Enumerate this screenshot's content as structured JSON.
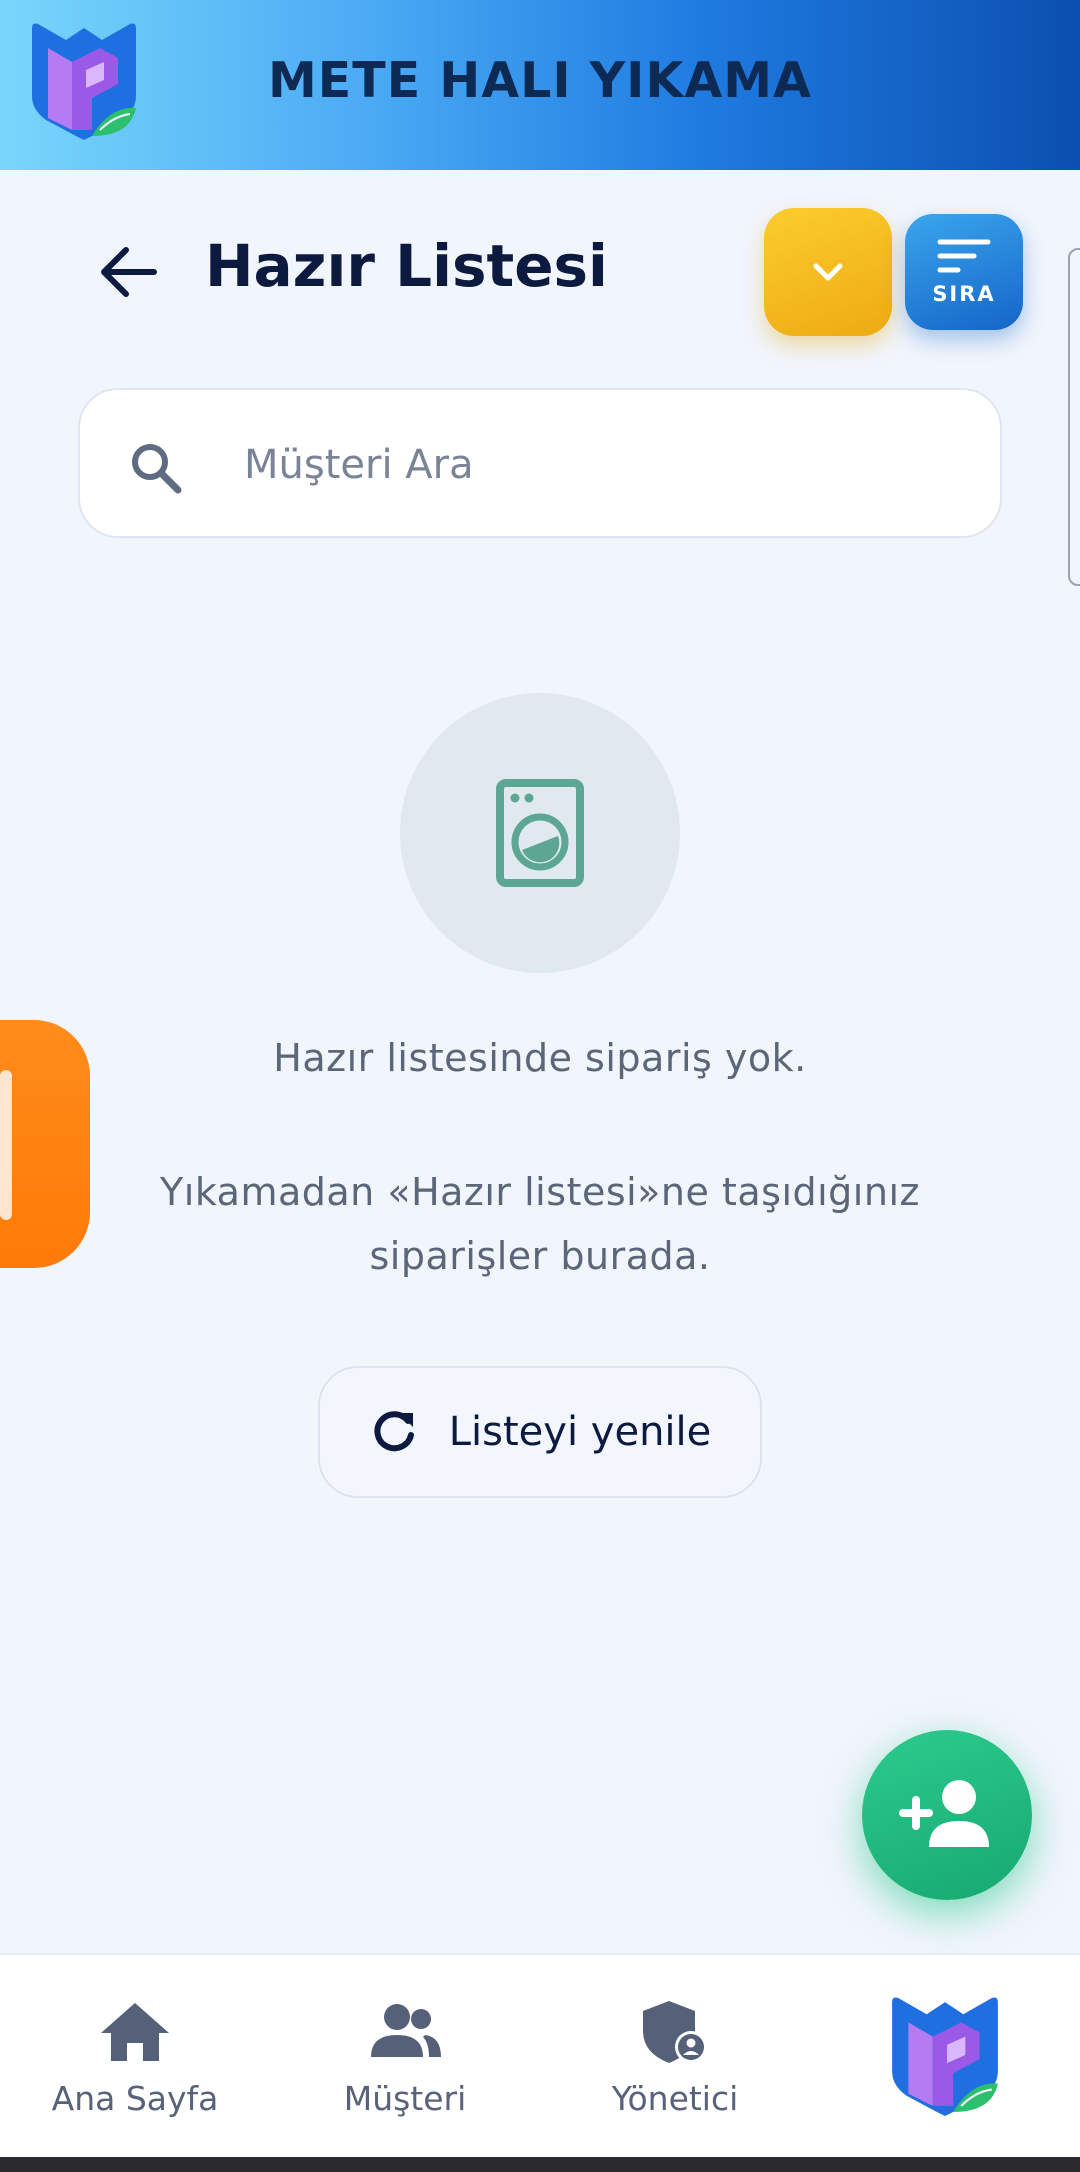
{
  "header": {
    "title": "METE HALI YIKAMA",
    "logo_icon": "app-logo-icon"
  },
  "page": {
    "title": "Hazır Listesi",
    "back_icon": "arrow-left-icon"
  },
  "toolbar": {
    "dropdown_icon": "chevron-down-icon",
    "sort_label": "SIRA",
    "sort_icon": "sort-lines-icon"
  },
  "search": {
    "placeholder": "Müşteri Ara",
    "value": ""
  },
  "empty_state": {
    "icon": "washing-machine-icon",
    "title": "Hazır listesinde sipariş yok.",
    "description": "Yıkamadan «Hazır listesi»ne taşıdığınız siparişler burada.",
    "refresh_label": "Listeyi yenile",
    "refresh_icon": "refresh-icon"
  },
  "fab": {
    "icon": "person-add-icon"
  },
  "bottom_nav": {
    "items": [
      {
        "label": "Ana Sayfa",
        "icon": "home-icon"
      },
      {
        "label": "Müşteri",
        "icon": "people-icon"
      },
      {
        "label": "Yönetici",
        "icon": "admin-shield-icon"
      }
    ],
    "logo_icon": "app-logo-icon"
  },
  "colors": {
    "accent_yellow": "#F2B51A",
    "accent_blue": "#1F78DA",
    "accent_green": "#1FB57E",
    "accent_orange": "#FF800F",
    "title_dark": "#0C1A40"
  }
}
